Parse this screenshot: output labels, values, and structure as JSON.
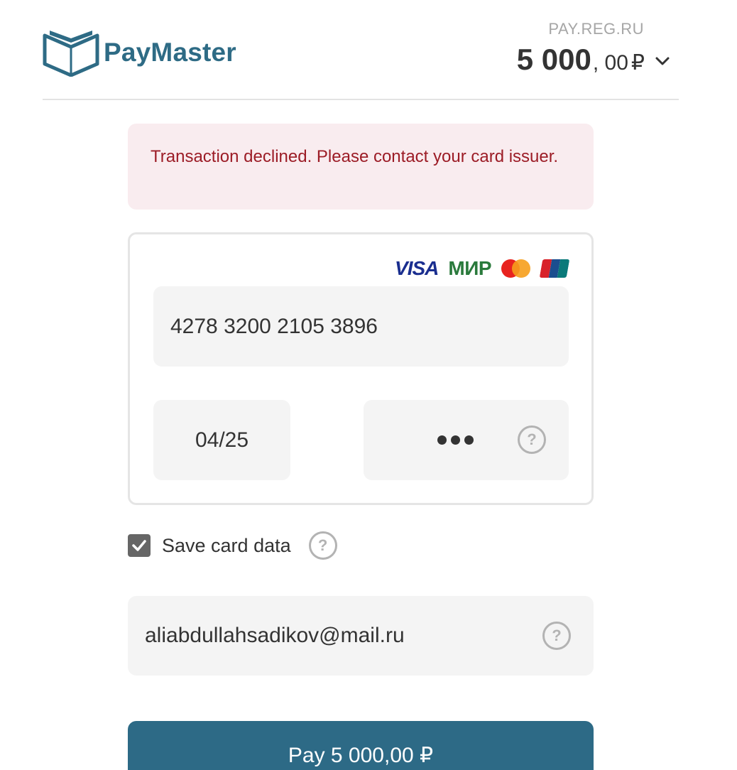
{
  "header": {
    "logo_text": "PayMaster",
    "merchant": "PAY.REG.RU",
    "amount_int": "5 000",
    "amount_dec": ", 00",
    "amount_currency": "₽",
    "logo_icon": "open-book-icon",
    "expand_icon": "chevron-down-icon"
  },
  "error": {
    "message": "Transaction declined. Please contact your card issuer."
  },
  "card": {
    "brands": [
      "VISA",
      "МИР",
      "mastercard-icon",
      "unionpay-icon"
    ],
    "visa_label": "VISA",
    "mir_label": "МИР",
    "number": "4278 3200 2105 3896",
    "expiry": "04/25",
    "cvv_help_icon": "question-circle-icon"
  },
  "save_card": {
    "checked": true,
    "label": "Save card data",
    "help_icon": "question-circle-icon"
  },
  "email": {
    "value": "aliabdullahsadikov@mail.ru",
    "help_icon": "question-circle-icon"
  },
  "pay_button": {
    "label": "Pay 5 000,00 ₽"
  },
  "colors": {
    "brand": "#2e6b85",
    "button": "#2d6a86",
    "error_bg": "#f9ecef",
    "error_text": "#9c1c26",
    "field_bg": "#f4f4f4"
  }
}
